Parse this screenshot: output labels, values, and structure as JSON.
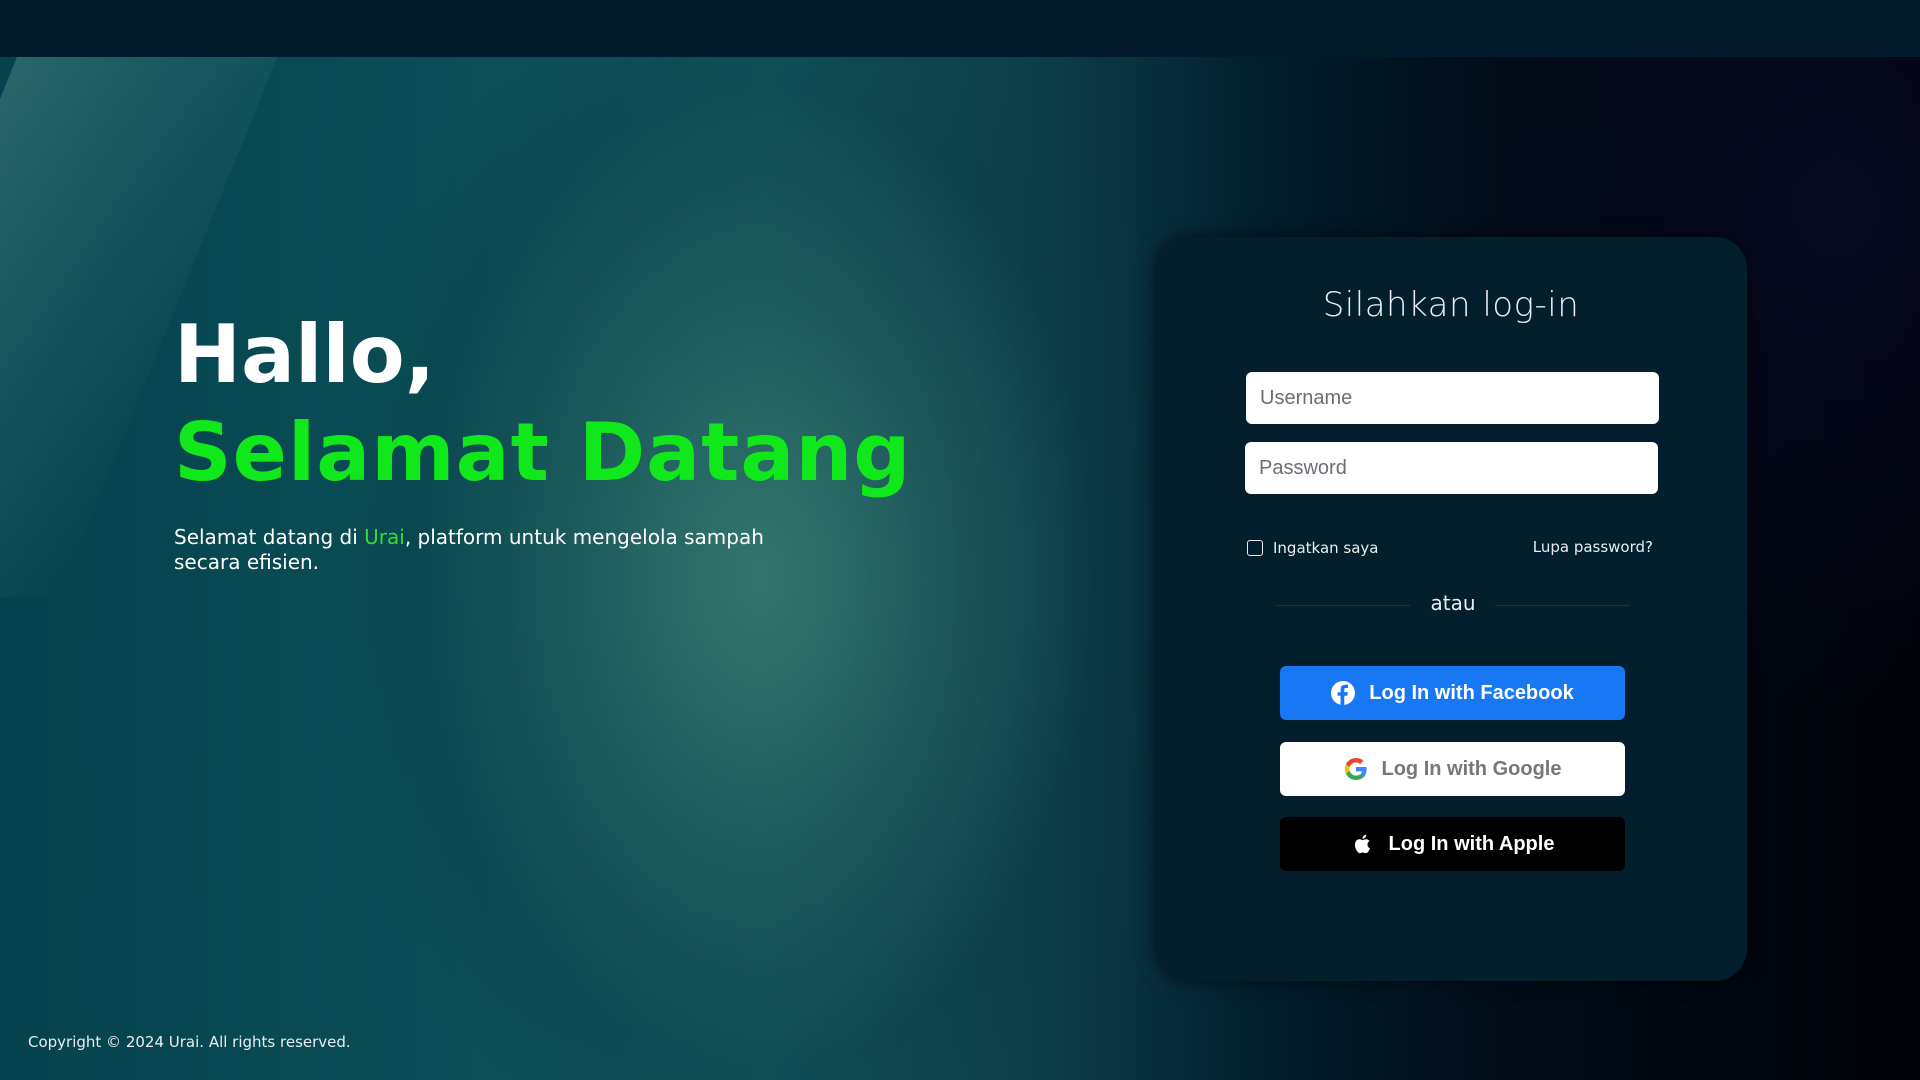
{
  "hero": {
    "greeting": "Hallo,",
    "headline": "Selamat Datang",
    "description_prefix": "Selamat datang di ",
    "brand_name": "Urai",
    "description_suffix": ", platform untuk mengelola sampah secara efisien."
  },
  "footer": {
    "copyright": "Copyright © 2024 Urai. All rights reserved."
  },
  "login": {
    "title": "Silahkan log-in",
    "username_placeholder": "Username",
    "password_placeholder": "Password",
    "remember_label": "Ingatkan saya",
    "forgot_label": "Lupa password?",
    "divider_label": "atau",
    "facebook_label": "Log In with Facebook",
    "google_label": "Log In with Google",
    "apple_label": "Log In with Apple"
  },
  "icons": {
    "facebook": "facebook-icon",
    "google": "google-icon",
    "apple": "apple-icon"
  },
  "colors": {
    "accent_green": "#10e81c",
    "facebook_blue": "#1877f2",
    "card_background": "#031e2c"
  }
}
